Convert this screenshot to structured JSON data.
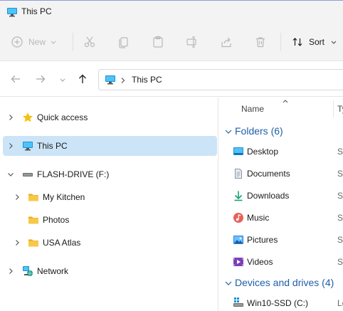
{
  "window": {
    "title": "This PC"
  },
  "toolbar": {
    "new_label": "New",
    "sort_label": "Sort"
  },
  "address": {
    "path": "This PC"
  },
  "nav_pane": {
    "items": [
      {
        "label": "Quick access"
      },
      {
        "label": "This PC"
      },
      {
        "label": "FLASH-DRIVE (F:)"
      },
      {
        "label": "My Kitchen"
      },
      {
        "label": "Photos"
      },
      {
        "label": "USA Atlas"
      },
      {
        "label": "Network"
      }
    ]
  },
  "content": {
    "columns": {
      "name": "Name",
      "type_partial": "Ty"
    },
    "folders_header": "Folders (6)",
    "folders": [
      {
        "name": "Desktop",
        "type_partial": "Sy"
      },
      {
        "name": "Documents",
        "type_partial": "Sy"
      },
      {
        "name": "Downloads",
        "type_partial": "Sy"
      },
      {
        "name": "Music",
        "type_partial": "Sy"
      },
      {
        "name": "Pictures",
        "type_partial": "Sy"
      },
      {
        "name": "Videos",
        "type_partial": "Sy"
      }
    ],
    "drives_header": "Devices and drives (4)",
    "drives": [
      {
        "name": "Win10-SSD (C:)",
        "type_partial": "Lo"
      }
    ]
  },
  "colors": {
    "accent": "#0067c0",
    "selection": "#cce4f7",
    "group_header": "#1f5fa8",
    "folder_yellow": "#f4c542"
  }
}
